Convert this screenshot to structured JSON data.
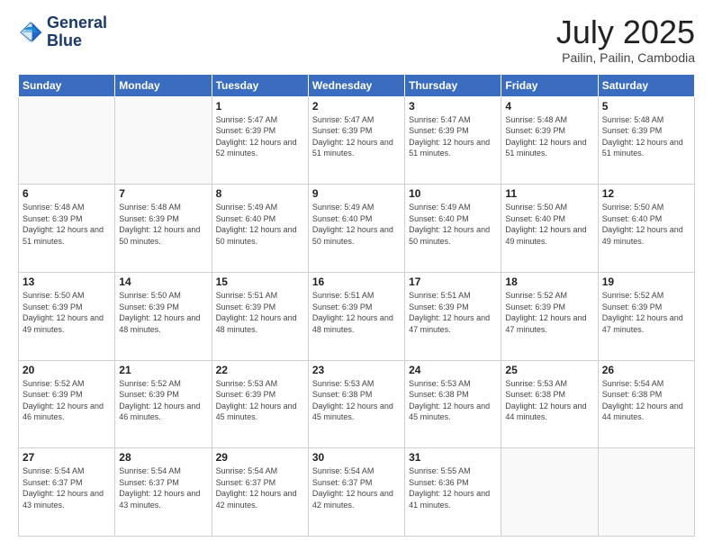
{
  "header": {
    "logo_line1": "General",
    "logo_line2": "Blue",
    "title": "July 2025",
    "subtitle": "Pailin, Pailin, Cambodia"
  },
  "days_of_week": [
    "Sunday",
    "Monday",
    "Tuesday",
    "Wednesday",
    "Thursday",
    "Friday",
    "Saturday"
  ],
  "weeks": [
    [
      {
        "day": "",
        "info": ""
      },
      {
        "day": "",
        "info": ""
      },
      {
        "day": "1",
        "info": "Sunrise: 5:47 AM\nSunset: 6:39 PM\nDaylight: 12 hours and 52 minutes."
      },
      {
        "day": "2",
        "info": "Sunrise: 5:47 AM\nSunset: 6:39 PM\nDaylight: 12 hours and 51 minutes."
      },
      {
        "day": "3",
        "info": "Sunrise: 5:47 AM\nSunset: 6:39 PM\nDaylight: 12 hours and 51 minutes."
      },
      {
        "day": "4",
        "info": "Sunrise: 5:48 AM\nSunset: 6:39 PM\nDaylight: 12 hours and 51 minutes."
      },
      {
        "day": "5",
        "info": "Sunrise: 5:48 AM\nSunset: 6:39 PM\nDaylight: 12 hours and 51 minutes."
      }
    ],
    [
      {
        "day": "6",
        "info": "Sunrise: 5:48 AM\nSunset: 6:39 PM\nDaylight: 12 hours and 51 minutes."
      },
      {
        "day": "7",
        "info": "Sunrise: 5:48 AM\nSunset: 6:39 PM\nDaylight: 12 hours and 50 minutes."
      },
      {
        "day": "8",
        "info": "Sunrise: 5:49 AM\nSunset: 6:40 PM\nDaylight: 12 hours and 50 minutes."
      },
      {
        "day": "9",
        "info": "Sunrise: 5:49 AM\nSunset: 6:40 PM\nDaylight: 12 hours and 50 minutes."
      },
      {
        "day": "10",
        "info": "Sunrise: 5:49 AM\nSunset: 6:40 PM\nDaylight: 12 hours and 50 minutes."
      },
      {
        "day": "11",
        "info": "Sunrise: 5:50 AM\nSunset: 6:40 PM\nDaylight: 12 hours and 49 minutes."
      },
      {
        "day": "12",
        "info": "Sunrise: 5:50 AM\nSunset: 6:40 PM\nDaylight: 12 hours and 49 minutes."
      }
    ],
    [
      {
        "day": "13",
        "info": "Sunrise: 5:50 AM\nSunset: 6:39 PM\nDaylight: 12 hours and 49 minutes."
      },
      {
        "day": "14",
        "info": "Sunrise: 5:50 AM\nSunset: 6:39 PM\nDaylight: 12 hours and 48 minutes."
      },
      {
        "day": "15",
        "info": "Sunrise: 5:51 AM\nSunset: 6:39 PM\nDaylight: 12 hours and 48 minutes."
      },
      {
        "day": "16",
        "info": "Sunrise: 5:51 AM\nSunset: 6:39 PM\nDaylight: 12 hours and 48 minutes."
      },
      {
        "day": "17",
        "info": "Sunrise: 5:51 AM\nSunset: 6:39 PM\nDaylight: 12 hours and 47 minutes."
      },
      {
        "day": "18",
        "info": "Sunrise: 5:52 AM\nSunset: 6:39 PM\nDaylight: 12 hours and 47 minutes."
      },
      {
        "day": "19",
        "info": "Sunrise: 5:52 AM\nSunset: 6:39 PM\nDaylight: 12 hours and 47 minutes."
      }
    ],
    [
      {
        "day": "20",
        "info": "Sunrise: 5:52 AM\nSunset: 6:39 PM\nDaylight: 12 hours and 46 minutes."
      },
      {
        "day": "21",
        "info": "Sunrise: 5:52 AM\nSunset: 6:39 PM\nDaylight: 12 hours and 46 minutes."
      },
      {
        "day": "22",
        "info": "Sunrise: 5:53 AM\nSunset: 6:39 PM\nDaylight: 12 hours and 45 minutes."
      },
      {
        "day": "23",
        "info": "Sunrise: 5:53 AM\nSunset: 6:38 PM\nDaylight: 12 hours and 45 minutes."
      },
      {
        "day": "24",
        "info": "Sunrise: 5:53 AM\nSunset: 6:38 PM\nDaylight: 12 hours and 45 minutes."
      },
      {
        "day": "25",
        "info": "Sunrise: 5:53 AM\nSunset: 6:38 PM\nDaylight: 12 hours and 44 minutes."
      },
      {
        "day": "26",
        "info": "Sunrise: 5:54 AM\nSunset: 6:38 PM\nDaylight: 12 hours and 44 minutes."
      }
    ],
    [
      {
        "day": "27",
        "info": "Sunrise: 5:54 AM\nSunset: 6:37 PM\nDaylight: 12 hours and 43 minutes."
      },
      {
        "day": "28",
        "info": "Sunrise: 5:54 AM\nSunset: 6:37 PM\nDaylight: 12 hours and 43 minutes."
      },
      {
        "day": "29",
        "info": "Sunrise: 5:54 AM\nSunset: 6:37 PM\nDaylight: 12 hours and 42 minutes."
      },
      {
        "day": "30",
        "info": "Sunrise: 5:54 AM\nSunset: 6:37 PM\nDaylight: 12 hours and 42 minutes."
      },
      {
        "day": "31",
        "info": "Sunrise: 5:55 AM\nSunset: 6:36 PM\nDaylight: 12 hours and 41 minutes."
      },
      {
        "day": "",
        "info": ""
      },
      {
        "day": "",
        "info": ""
      }
    ]
  ]
}
